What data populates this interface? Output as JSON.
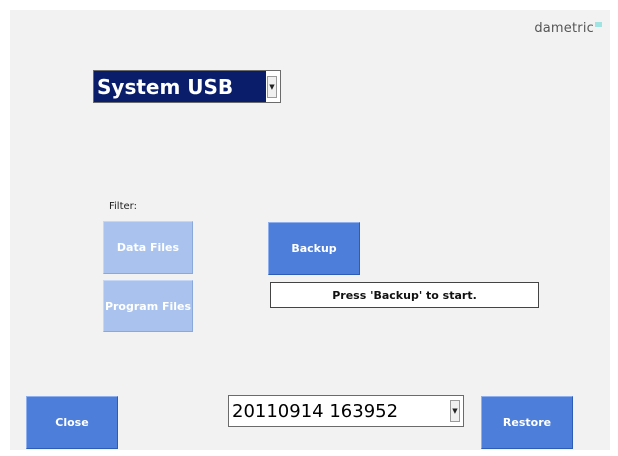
{
  "brand": {
    "name": "dametric"
  },
  "device_select": {
    "value": "System USB",
    "arrow_icon": "dropdown-arrow-icon"
  },
  "filter": {
    "label": "Filter:",
    "data_files": "Data Files",
    "program_files": "Program Files"
  },
  "actions": {
    "backup_label": "Backup",
    "status_text": "Press 'Backup' to start.",
    "close_label": "Close",
    "restore_label": "Restore"
  },
  "backup_select": {
    "value": "20110914 163952",
    "arrow_icon": "dropdown-arrow-icon"
  },
  "colors": {
    "button": "#4d7ed9",
    "filter_button": "#a9c3ee",
    "select_highlight": "#0a1d6b",
    "panel_background": "#f2f2f2"
  }
}
